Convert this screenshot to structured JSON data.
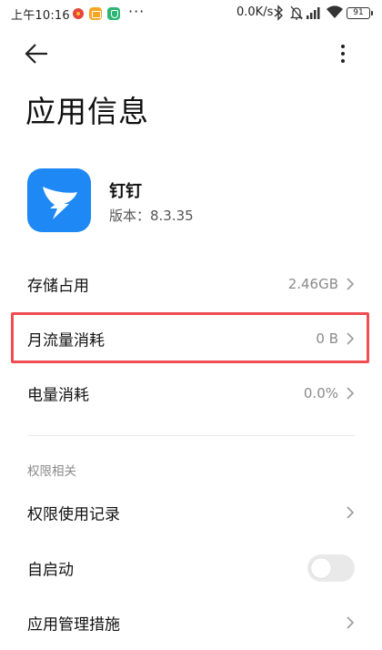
{
  "status_bar": {
    "time": "上午10:16",
    "notification_icons": [
      "weibo-icon",
      "notes-icon",
      "security-icon"
    ],
    "more_indicator": "···",
    "net_speed": "0.0K/s",
    "battery_level": "91"
  },
  "toolbar": {
    "back_icon": "arrow-left-icon",
    "more_icon": "more-vertical-icon"
  },
  "page": {
    "title": "应用信息"
  },
  "app": {
    "name": "钉钉",
    "version": "版本：8.3.35",
    "icon_color": "#1e88f4"
  },
  "rows": {
    "storage": {
      "label": "存储占用",
      "value": "2.46GB"
    },
    "traffic": {
      "label": "月流量消耗",
      "value": "0 B"
    },
    "battery": {
      "label": "电量消耗",
      "value": "0.0%"
    }
  },
  "permissions": {
    "section_title": "权限相关",
    "items": [
      {
        "label": "权限使用记录"
      },
      {
        "label": "自启动",
        "toggle_on": false
      },
      {
        "label": "应用管理措施"
      }
    ]
  },
  "colors": {
    "highlight": "#ee4d52",
    "secondary_text": "#8a8a8a"
  }
}
